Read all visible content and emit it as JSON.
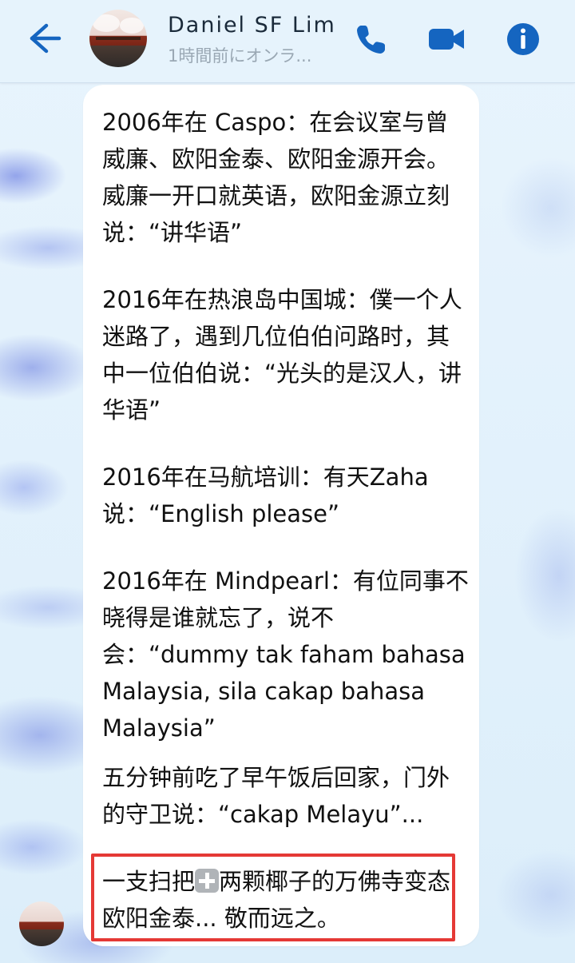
{
  "header": {
    "contact_name": "Daniel SF Lim",
    "status": "1時間前にオンラ..."
  },
  "message": {
    "paragraphs": [
      "2006年在 Caspo：在会议室与曾威廉、欧阳金泰、欧阳金源开会。威廉一开口就英语，欧阳金源立刻说：“讲华语”",
      "2016年在热浪岛中国城：僕一个人迷路了，遇到几位伯伯问路时，其中一位伯伯说：“光头的是汉人，讲华语”",
      "2016年在马航培训：有天Zaha说：“English please”",
      "2016年在 Mindpearl：有位同事不晓得是谁就忘了，说不会：“dummy tak faham bahasa Malaysia, sila cakap bahasa Malaysia”",
      "五分钟前吃了早午饭后回家，门外的守卫说：“cakap Melayu”..."
    ],
    "highlight_before": "一支扫把",
    "highlight_after": "两颗椰子的万佛寺变态欧阳金泰... 敬而远之。"
  },
  "colors": {
    "accent": "#1565c0",
    "highlight_border": "#e53935",
    "bubble": "#ffffff"
  },
  "icons": [
    "back-arrow-icon",
    "phone-icon",
    "video-camera-icon",
    "info-icon",
    "plus-icon"
  ]
}
